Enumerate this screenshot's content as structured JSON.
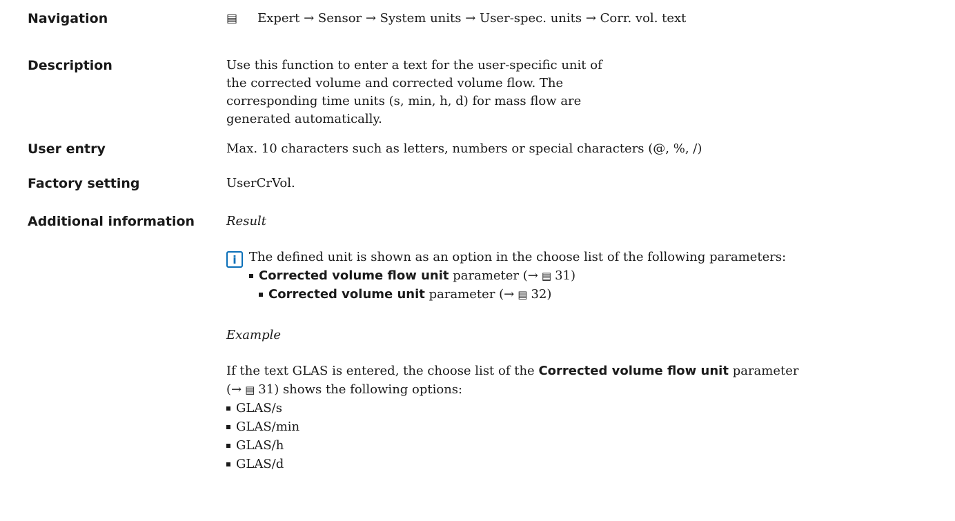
{
  "navigation": {
    "label": "Navigation",
    "icon": "menu-book-icon",
    "path": "Expert → Sensor → System units → User-spec. units → Corr. vol. text"
  },
  "description": {
    "label": "Description",
    "text": "Use this function to enter a text for the user-specific unit of the corrected volume and corrected volume flow. The corresponding time units (s, min, h, d) for mass flow are generated automatically."
  },
  "user_entry": {
    "label": "User entry",
    "text": "Max. 10 characters such as letters, numbers or special characters (@, %, /)"
  },
  "factory_setting": {
    "label": "Factory setting",
    "value": "UserCrVol."
  },
  "additional_info": {
    "label": "Additional information",
    "result_heading": "Result",
    "info_text": "The defined unit is shown as an option in the choose list of the following parameters:",
    "params": [
      {
        "name": "Corrected volume flow unit",
        "suffix": "parameter (→",
        "page": "31)"
      },
      {
        "name": "Corrected volume unit",
        "suffix": "parameter (→",
        "page": "32)"
      }
    ],
    "example_heading": "Example",
    "example_pre": "If the text GLAS is entered, the choose list of the",
    "example_param": "Corrected volume flow unit",
    "example_post": "parameter",
    "example_line2_pre": "(→",
    "example_line2_page": "31) shows the following options:",
    "options": [
      "GLAS/s",
      "GLAS/min",
      "GLAS/h",
      "GLAS/d"
    ]
  }
}
